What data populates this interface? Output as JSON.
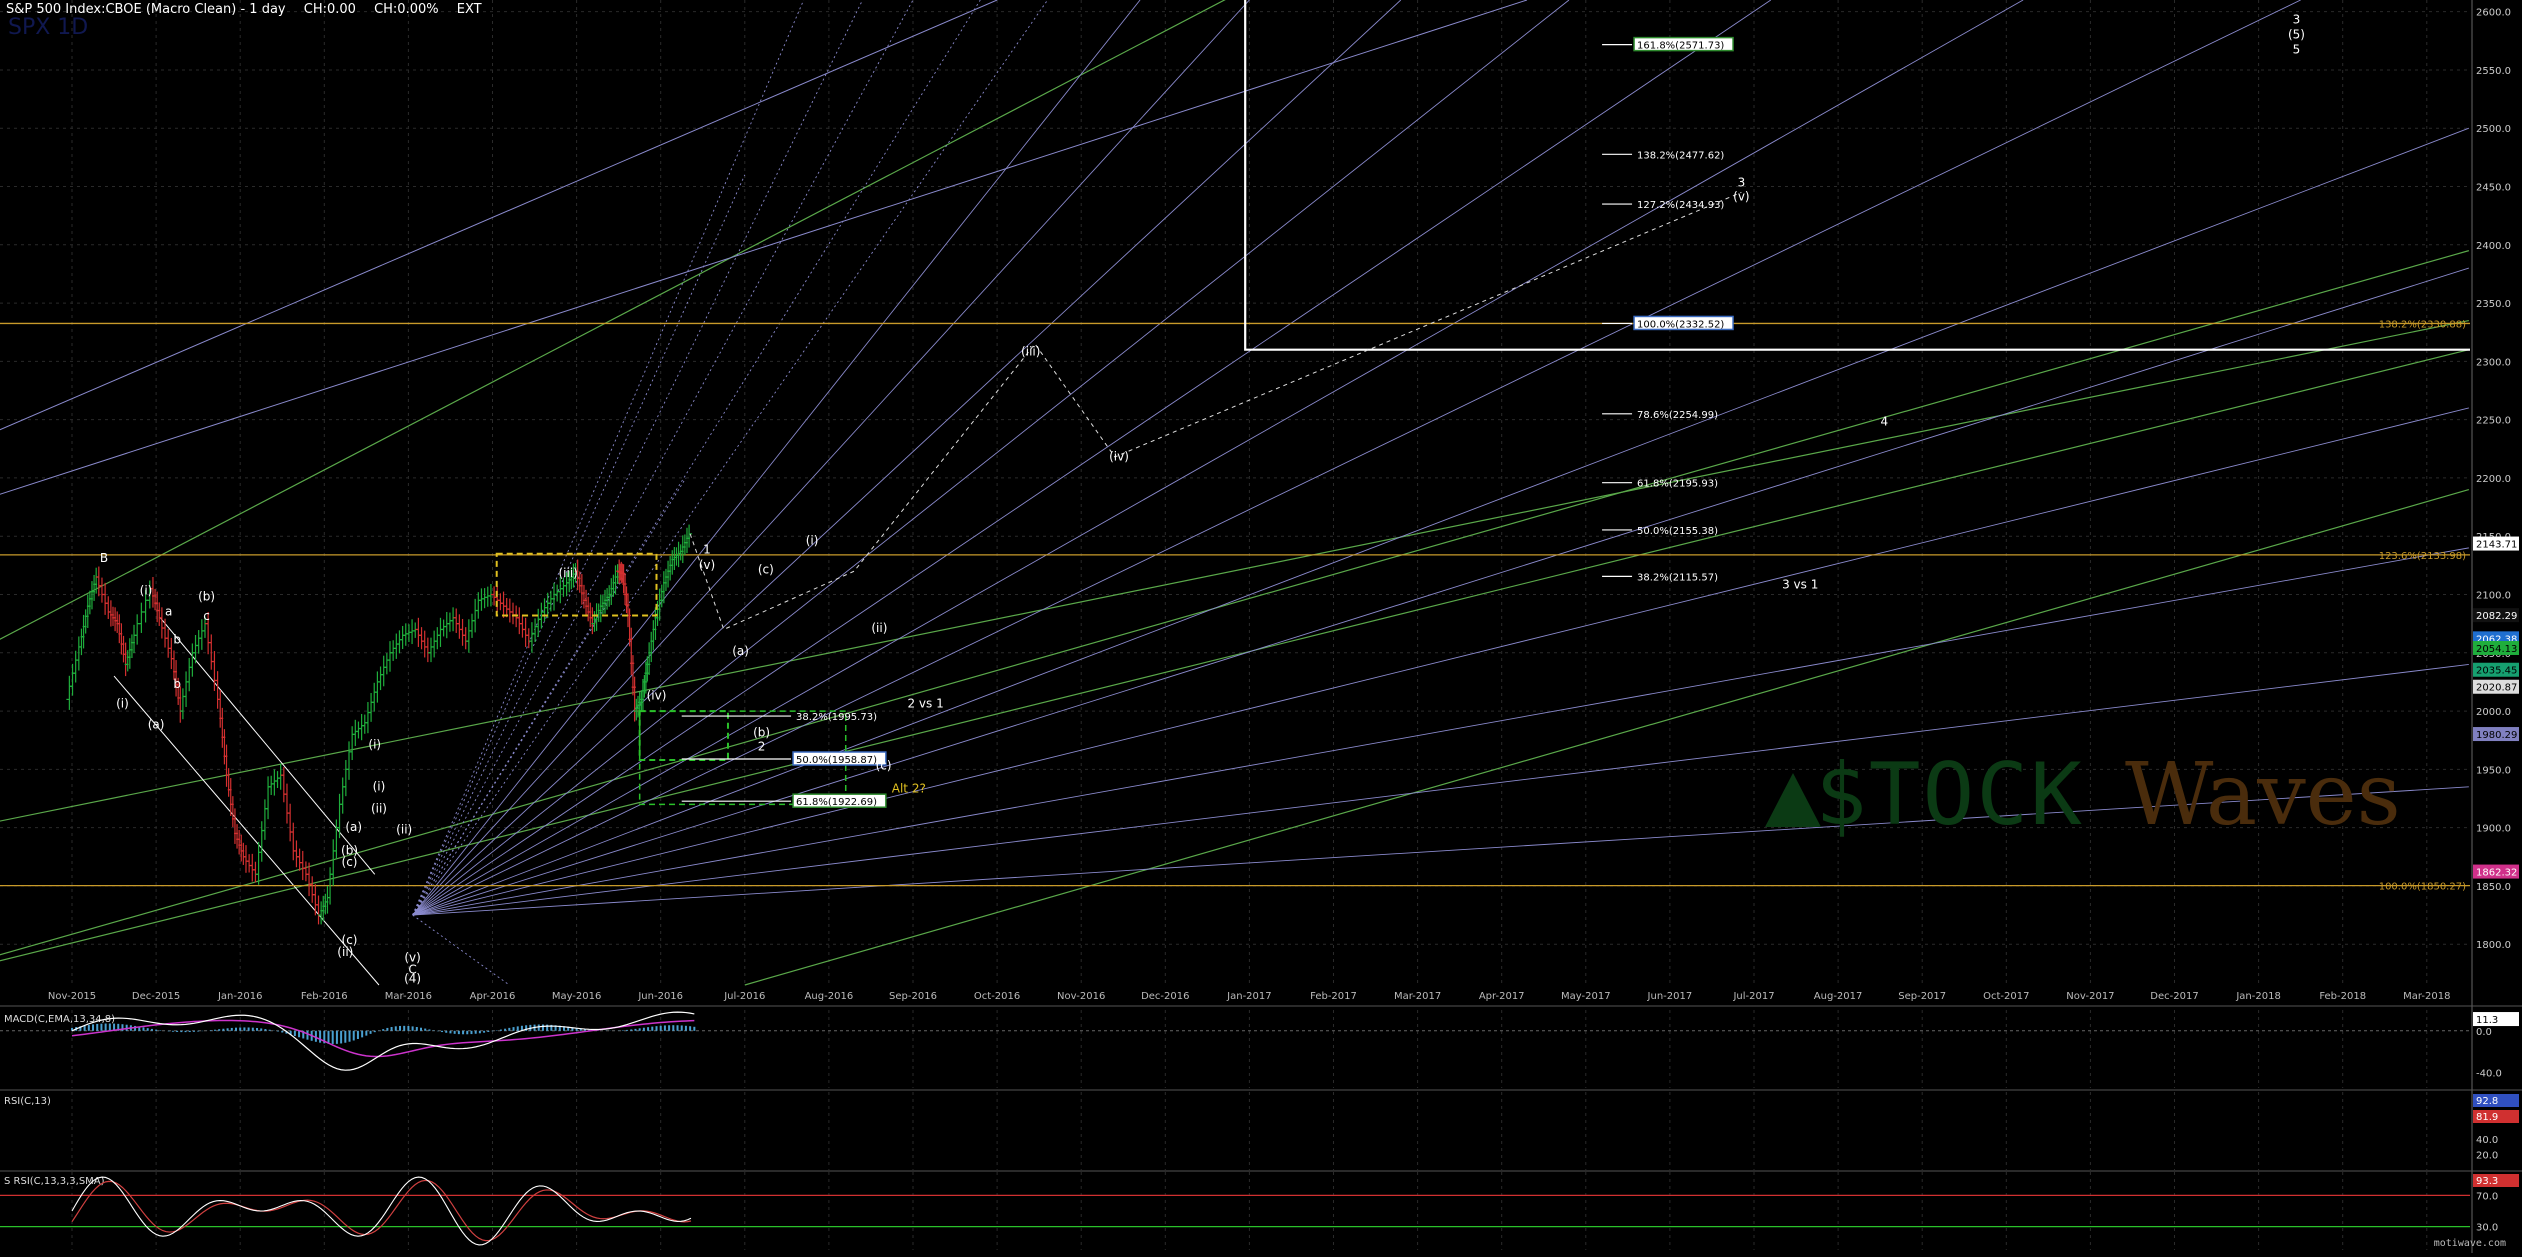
{
  "header": {
    "symbol": "S&P 500 Index:CBOE (Macro Clean) - 1 day",
    "change": "CH:0.00",
    "change_pct": "CH:0.00%",
    "ext": "EXT",
    "ticker_faint": "SPX 1D"
  },
  "watermark": {
    "left": "$TOCK",
    "right": "Waves"
  },
  "credit": "motiwave.com",
  "colors": {
    "background": "#000000",
    "grid": "#2a2a2a",
    "up_bar": "#1fae3c",
    "down_bar": "#d43030",
    "fib_line": "#c89a2a",
    "fan_line": "#8a8acd",
    "channel_line": "#5aa84a",
    "macd_line": "#ffffff",
    "macd_signal": "#cc33cc",
    "macd_hist": "#4aa0d0"
  },
  "chart_data": [
    {
      "type": "line",
      "name": "price",
      "y_axis_ticks": [
        1800,
        1850,
        1900,
        1950,
        2000,
        2050,
        2100,
        2150,
        2200,
        2250,
        2300,
        2350,
        2400,
        2450,
        2500,
        2550,
        2600
      ],
      "ylim": [
        1765,
        2610
      ],
      "x_axis_ticks": [
        "Nov-2015",
        "Dec-2015",
        "Jan-2016",
        "Feb-2016",
        "Mar-2016",
        "Apr-2016",
        "May-2016",
        "Jun-2016",
        "Jul-2016",
        "Aug-2016",
        "Sep-2016",
        "Oct-2016",
        "Nov-2016",
        "Dec-2016",
        "Jan-2017",
        "Feb-2017",
        "Mar-2017",
        "Apr-2017",
        "May-2017",
        "Jun-2017",
        "Jul-2017",
        "Aug-2017",
        "Sep-2017",
        "Oct-2017",
        "Nov-2017",
        "Dec-2017",
        "Jan-2018",
        "Feb-2018",
        "Mar-2018"
      ],
      "x_tick_index": [
        0,
        1,
        2,
        3,
        4,
        5,
        6,
        7,
        8,
        9,
        10,
        11,
        12,
        13,
        14,
        15,
        16,
        17,
        18,
        19,
        20,
        21,
        22,
        23,
        24,
        25,
        26,
        27,
        28
      ],
      "price_path": [
        [
          -0.05,
          2010
        ],
        [
          0.1,
          2055
        ],
        [
          0.2,
          2090
        ],
        [
          0.3,
          2115
        ],
        [
          0.45,
          2085
        ],
        [
          0.55,
          2075
        ],
        [
          0.65,
          2040
        ],
        [
          0.75,
          2065
        ],
        [
          0.95,
          2105
        ],
        [
          1.05,
          2080
        ],
        [
          1.2,
          2045
        ],
        [
          1.3,
          2000
        ],
        [
          1.45,
          2050
        ],
        [
          1.6,
          2075
        ],
        [
          1.75,
          2010
        ],
        [
          1.85,
          1945
        ],
        [
          1.95,
          1895
        ],
        [
          2.05,
          1875
        ],
        [
          2.2,
          1860
        ],
        [
          2.35,
          1935
        ],
        [
          2.5,
          1945
        ],
        [
          2.65,
          1880
        ],
        [
          2.8,
          1860
        ],
        [
          2.95,
          1825
        ],
        [
          3.05,
          1840
        ],
        [
          3.2,
          1920
        ],
        [
          3.35,
          1980
        ],
        [
          3.5,
          1990
        ],
        [
          3.65,
          2025
        ],
        [
          3.8,
          2050
        ],
        [
          3.95,
          2065
        ],
        [
          4.1,
          2070
        ],
        [
          4.25,
          2050
        ],
        [
          4.4,
          2070
        ],
        [
          4.55,
          2080
        ],
        [
          4.7,
          2060
        ],
        [
          4.85,
          2095
        ],
        [
          5.0,
          2100
        ],
        [
          5.15,
          2090
        ],
        [
          5.3,
          2080
        ],
        [
          5.45,
          2060
        ],
        [
          5.6,
          2085
        ],
        [
          5.75,
          2100
        ],
        [
          5.9,
          2110
        ],
        [
          6.0,
          2120
        ],
        [
          6.1,
          2095
        ],
        [
          6.2,
          2075
        ],
        [
          6.3,
          2090
        ],
        [
          6.4,
          2100
        ],
        [
          6.5,
          2120
        ],
        [
          6.55,
          2118
        ],
        [
          6.62,
          2082
        ],
        [
          6.7,
          2000
        ],
        [
          6.78,
          2010
        ],
        [
          6.85,
          2040
        ],
        [
          6.95,
          2080
        ],
        [
          7.05,
          2110
        ],
        [
          7.15,
          2130
        ],
        [
          7.25,
          2137
        ],
        [
          7.35,
          2152
        ]
      ],
      "horizontal_levels": [
        {
          "value": 2332.52,
          "label_right": "138.2%(2330.88)"
        },
        {
          "value": 2133.98,
          "label_right": "123.6%(2133.98)"
        },
        {
          "value": 1850.27,
          "label_right": "100.0%(1850.27)"
        }
      ],
      "price_labels": [
        {
          "value": 2143.71,
          "text": "2143.71",
          "color": "#ffffff",
          "text_color": "#000000"
        },
        {
          "value": 2082.29,
          "text": "2082.29",
          "color": "#111111",
          "text_color": "#ffffff"
        },
        {
          "value": 2062.38,
          "text": "2062.38",
          "color": "#1f6fd0",
          "text_color": "#ffffff"
        },
        {
          "value": 2054.13,
          "text": "2054.13",
          "color": "#1fae3c",
          "text_color": "#000000"
        },
        {
          "value": 2035.45,
          "text": "2035.45",
          "color": "#16a070",
          "text_color": "#000000"
        },
        {
          "value": 2020.87,
          "text": "2020.87",
          "color": "#dddddd",
          "text_color": "#000000"
        },
        {
          "value": 1980.29,
          "text": "1980.29",
          "color": "#8080c0",
          "text_color": "#000000"
        },
        {
          "value": 1862.32,
          "text": "1862.32",
          "color": "#d0308a",
          "text_color": "#ffffff"
        }
      ],
      "fib_projections": [
        {
          "value": 2571.73,
          "text": "161.8%(2571.73)",
          "box": "#2e8b2e"
        },
        {
          "value": 2477.62,
          "text": "138.2%(2477.62)",
          "box": ""
        },
        {
          "value": 2434.93,
          "text": "127.2%(2434.93)",
          "box": ""
        },
        {
          "value": 2332.52,
          "text": "100.0%(2332.52)",
          "box": "#3a6ac0"
        },
        {
          "value": 2254.99,
          "text": "78.6%(2254.99)",
          "box": ""
        },
        {
          "value": 2195.93,
          "text": "61.8%(2195.93)",
          "box": ""
        },
        {
          "value": 2155.38,
          "text": "50.0%(2155.38)",
          "box": ""
        },
        {
          "value": 2115.57,
          "text": "38.2%(2115.57)",
          "box": ""
        }
      ],
      "retracements": [
        {
          "value": 1995.73,
          "text": "38.2%(1995.73)",
          "box": ""
        },
        {
          "value": 1958.87,
          "text": "50.0%(1958.87)",
          "box": "#3a6ac0"
        },
        {
          "value": 1922.69,
          "text": "61.8%(1922.69)",
          "box": "#2e8b2e"
        }
      ],
      "wave_labels": [
        {
          "x": 0.38,
          "v": 2128,
          "text": "B"
        },
        {
          "x": 0.88,
          "v": 2100,
          "text": "(i)"
        },
        {
          "x": 1.15,
          "v": 2082,
          "text": "a"
        },
        {
          "x": 1.25,
          "v": 2058,
          "text": "b"
        },
        {
          "x": 1.6,
          "v": 2095,
          "text": "(b)"
        },
        {
          "x": 1.6,
          "v": 2078,
          "text": "c"
        },
        {
          "x": 1.0,
          "v": 1985,
          "text": "(a)"
        },
        {
          "x": 1.25,
          "v": 2020,
          "text": "b"
        },
        {
          "x": 0.6,
          "v": 2003,
          "text": "(i)"
        },
        {
          "x": 3.6,
          "v": 1968,
          "text": "(i)"
        },
        {
          "x": 3.35,
          "v": 1897,
          "text": "(a)"
        },
        {
          "x": 3.3,
          "v": 1877,
          "text": "(b)"
        },
        {
          "x": 3.3,
          "v": 1867,
          "text": "(c)"
        },
        {
          "x": 3.3,
          "v": 1800,
          "text": "(c)"
        },
        {
          "x": 3.25,
          "v": 1790,
          "text": "(ii)"
        },
        {
          "x": 3.95,
          "v": 1895,
          "text": "(ii)"
        },
        {
          "x": 3.65,
          "v": 1932,
          "text": "(i)"
        },
        {
          "x": 3.65,
          "v": 1913,
          "text": "(ii)"
        },
        {
          "x": 4.05,
          "v": 1785,
          "text": "(v)"
        },
        {
          "x": 4.05,
          "v": 1775,
          "text": "C"
        },
        {
          "x": 4.05,
          "v": 1767,
          "text": "(4)"
        },
        {
          "x": 5.9,
          "v": 2115,
          "text": "(iii)"
        },
        {
          "x": 6.95,
          "v": 2010,
          "text": "(iv)"
        },
        {
          "x": 7.55,
          "v": 2135,
          "text": "1"
        },
        {
          "x": 7.55,
          "v": 2122,
          "text": "(v)"
        },
        {
          "x": 7.95,
          "v": 2048,
          "text": "(a)"
        },
        {
          "x": 8.25,
          "v": 2118,
          "text": "(c)"
        },
        {
          "x": 8.8,
          "v": 2143,
          "text": "(i)"
        },
        {
          "x": 9.6,
          "v": 2068,
          "text": "(ii)"
        },
        {
          "x": 8.2,
          "v": 1978,
          "text": "(b)"
        },
        {
          "x": 8.2,
          "v": 1966,
          "text": "2"
        },
        {
          "x": 9.65,
          "v": 1950,
          "text": "(c)"
        },
        {
          "x": 11.4,
          "v": 2305,
          "text": "(iii)"
        },
        {
          "x": 12.45,
          "v": 2215,
          "text": "(iv)"
        },
        {
          "x": 19.85,
          "v": 2450,
          "text": "3"
        },
        {
          "x": 19.85,
          "v": 2438,
          "text": "(v)"
        },
        {
          "x": 21.55,
          "v": 2245,
          "text": "4"
        },
        {
          "x": 26.45,
          "v": 2590,
          "text": "3"
        },
        {
          "x": 26.45,
          "v": 2577,
          "text": "(5)"
        },
        {
          "x": 26.45,
          "v": 2564,
          "text": "5"
        }
      ],
      "annotations": [
        {
          "x": 10.15,
          "v": 2003,
          "text": "2 vs 1",
          "color": "#ffffff"
        },
        {
          "x": 20.55,
          "v": 2105,
          "text": "3 vs 1",
          "color": "#ffffff"
        },
        {
          "x": 9.95,
          "v": 1930,
          "text": "Alt 2?",
          "color": "#e0c020"
        }
      ]
    },
    {
      "type": "line",
      "name": "MACD",
      "title": "MACD(C,EMA,13,34,8)",
      "legend_faint": "MACD(C,EMA,13,34,8)",
      "y_axis_ticks": [
        0.0,
        -40.0
      ],
      "ylim": [
        -55,
        20
      ],
      "current_label": "11.3"
    },
    {
      "type": "line",
      "name": "RSI",
      "title": "RSI(C,13)",
      "y_axis_ticks": [
        40.0,
        20.0
      ],
      "current_labels": [
        "92.8",
        "81.9"
      ],
      "ylim": [
        0,
        100
      ]
    },
    {
      "type": "line",
      "name": "Stochastic RSI",
      "title": "S RSI(C,13,3,3,SMA)",
      "y_axis_ticks": [
        70.0,
        30.0
      ],
      "current_labels": [
        "93.3"
      ],
      "ylim": [
        0,
        100
      ]
    }
  ]
}
